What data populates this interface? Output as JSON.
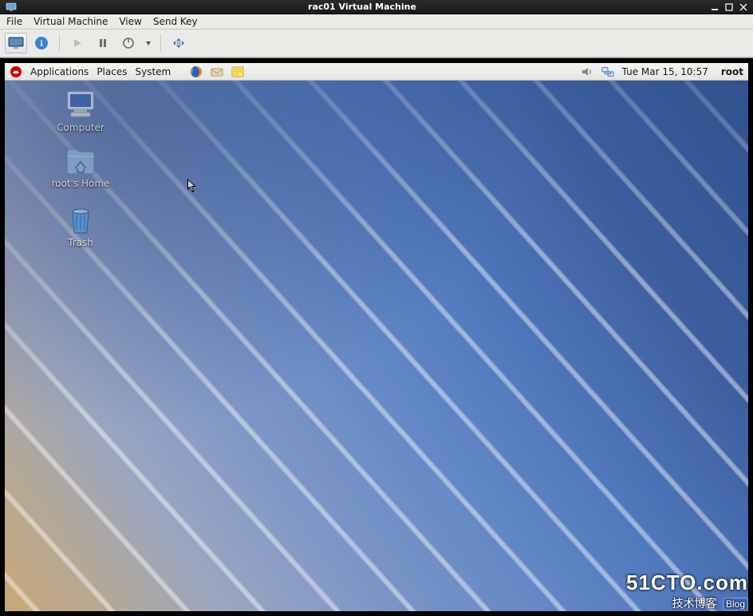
{
  "host": {
    "title": "rac01 Virtual Machine",
    "menu": {
      "file": "File",
      "vm": "Virtual Machine",
      "view": "View",
      "sendkey": "Send Key"
    }
  },
  "guest": {
    "panel": {
      "applications": "Applications",
      "places": "Places",
      "system": "System"
    },
    "clock": "Tue Mar 15, 10:57",
    "user": "root",
    "icons": {
      "computer": "Computer",
      "home": "root's Home",
      "trash": "Trash"
    }
  },
  "watermark": {
    "big": "51CTO.com",
    "small": "技术博客",
    "badge": "Blog"
  }
}
